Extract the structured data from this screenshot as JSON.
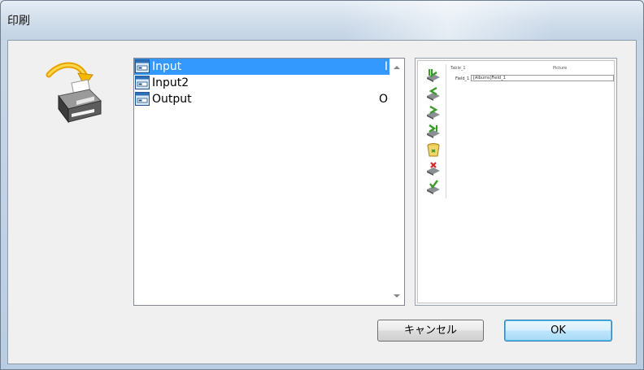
{
  "window": {
    "title": "印刷"
  },
  "list": {
    "items": [
      {
        "label": "Input",
        "suffix": "I",
        "selected": true,
        "icon": "form-icon"
      },
      {
        "label": "Input2",
        "suffix": "",
        "selected": false,
        "icon": "form-icon"
      },
      {
        "label": "Output",
        "suffix": "O",
        "selected": false,
        "icon": "form-icon"
      }
    ]
  },
  "preview": {
    "table_label": "Table_1",
    "picture_label": "Picture",
    "field_label": "Field_1 :",
    "field_value": "[Albums]Field_1",
    "tools": [
      "first-record-icon",
      "previous-record-icon",
      "next-record-icon",
      "last-record-icon",
      "trash-icon",
      "delete-record-icon",
      "validate-icon"
    ]
  },
  "buttons": {
    "cancel_label": "キャンセル",
    "ok_label": "OK"
  },
  "colors": {
    "selection": "#3399ff",
    "ok_border": "#3c7fb1"
  }
}
